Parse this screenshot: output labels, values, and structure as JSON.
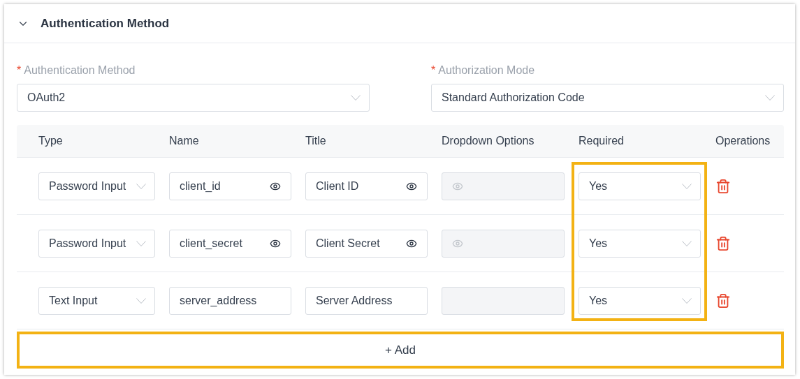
{
  "section": {
    "title": "Authentication Method",
    "expanded": true
  },
  "fields": [
    {
      "label": "Authentication Method",
      "required_mark": "*",
      "value": "OAuth2"
    },
    {
      "label": "Authorization Mode",
      "required_mark": "*",
      "value": "Standard Authorization Code"
    }
  ],
  "table": {
    "columns": [
      "Type",
      "Name",
      "Title",
      "Dropdown Options",
      "Required",
      "Operations"
    ],
    "required_column_highlighted": true,
    "rows": [
      {
        "kind": "password",
        "type": "Password Input",
        "name": "client_id",
        "title": "Client ID",
        "options_disabled": true,
        "required": "Yes"
      },
      {
        "kind": "password",
        "type": "Password Input",
        "name": "client_secret",
        "title": "Client Secret",
        "options_disabled": true,
        "required": "Yes"
      },
      {
        "kind": "text",
        "type": "Text Input",
        "name": "server_address",
        "title": "Server Address",
        "options_disabled": true,
        "required": "Yes"
      }
    ]
  },
  "add_button": {
    "label": "+ Add",
    "highlighted": true
  }
}
